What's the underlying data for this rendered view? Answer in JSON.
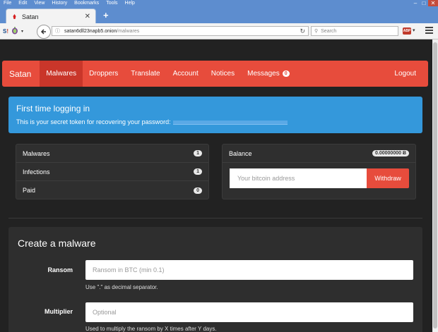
{
  "browser": {
    "menu": [
      "File",
      "Edit",
      "View",
      "History",
      "Bookmarks",
      "Tools",
      "Help"
    ],
    "tab_title": "Satan",
    "url_host": "satan6dll23napb5.onion",
    "url_path": "/malwares",
    "search_placeholder": "Search",
    "addon_label": "ABP"
  },
  "nav": {
    "brand": "Satan",
    "items": [
      "Malwares",
      "Droppers",
      "Translate",
      "Account",
      "Notices",
      "Messages"
    ],
    "messages_count": "0",
    "logout": "Logout"
  },
  "alert": {
    "title": "First time logging in",
    "text": "This is your secret token for recovering your password:"
  },
  "stats": [
    {
      "label": "Malwares",
      "count": "1"
    },
    {
      "label": "Infections",
      "count": "1"
    },
    {
      "label": "Paid",
      "count": "0"
    }
  ],
  "balance": {
    "label": "Balance",
    "amount": "0.00000000 Ƀ",
    "placeholder": "Your bitcoin address",
    "button": "Withdraw"
  },
  "create": {
    "title": "Create a malware",
    "ransom_label": "Ransom",
    "ransom_placeholder": "Ransom in BTC (min 0.1)",
    "ransom_help": "Use \".\" as decimal separator.",
    "multiplier_label": "Multiplier",
    "multiplier_placeholder": "Optional",
    "multiplier_help": "Used to multiply the ransom by X times after Y days."
  },
  "colors": {
    "accent": "#e74c3c",
    "info": "#3498db",
    "page_bg": "#222222"
  }
}
